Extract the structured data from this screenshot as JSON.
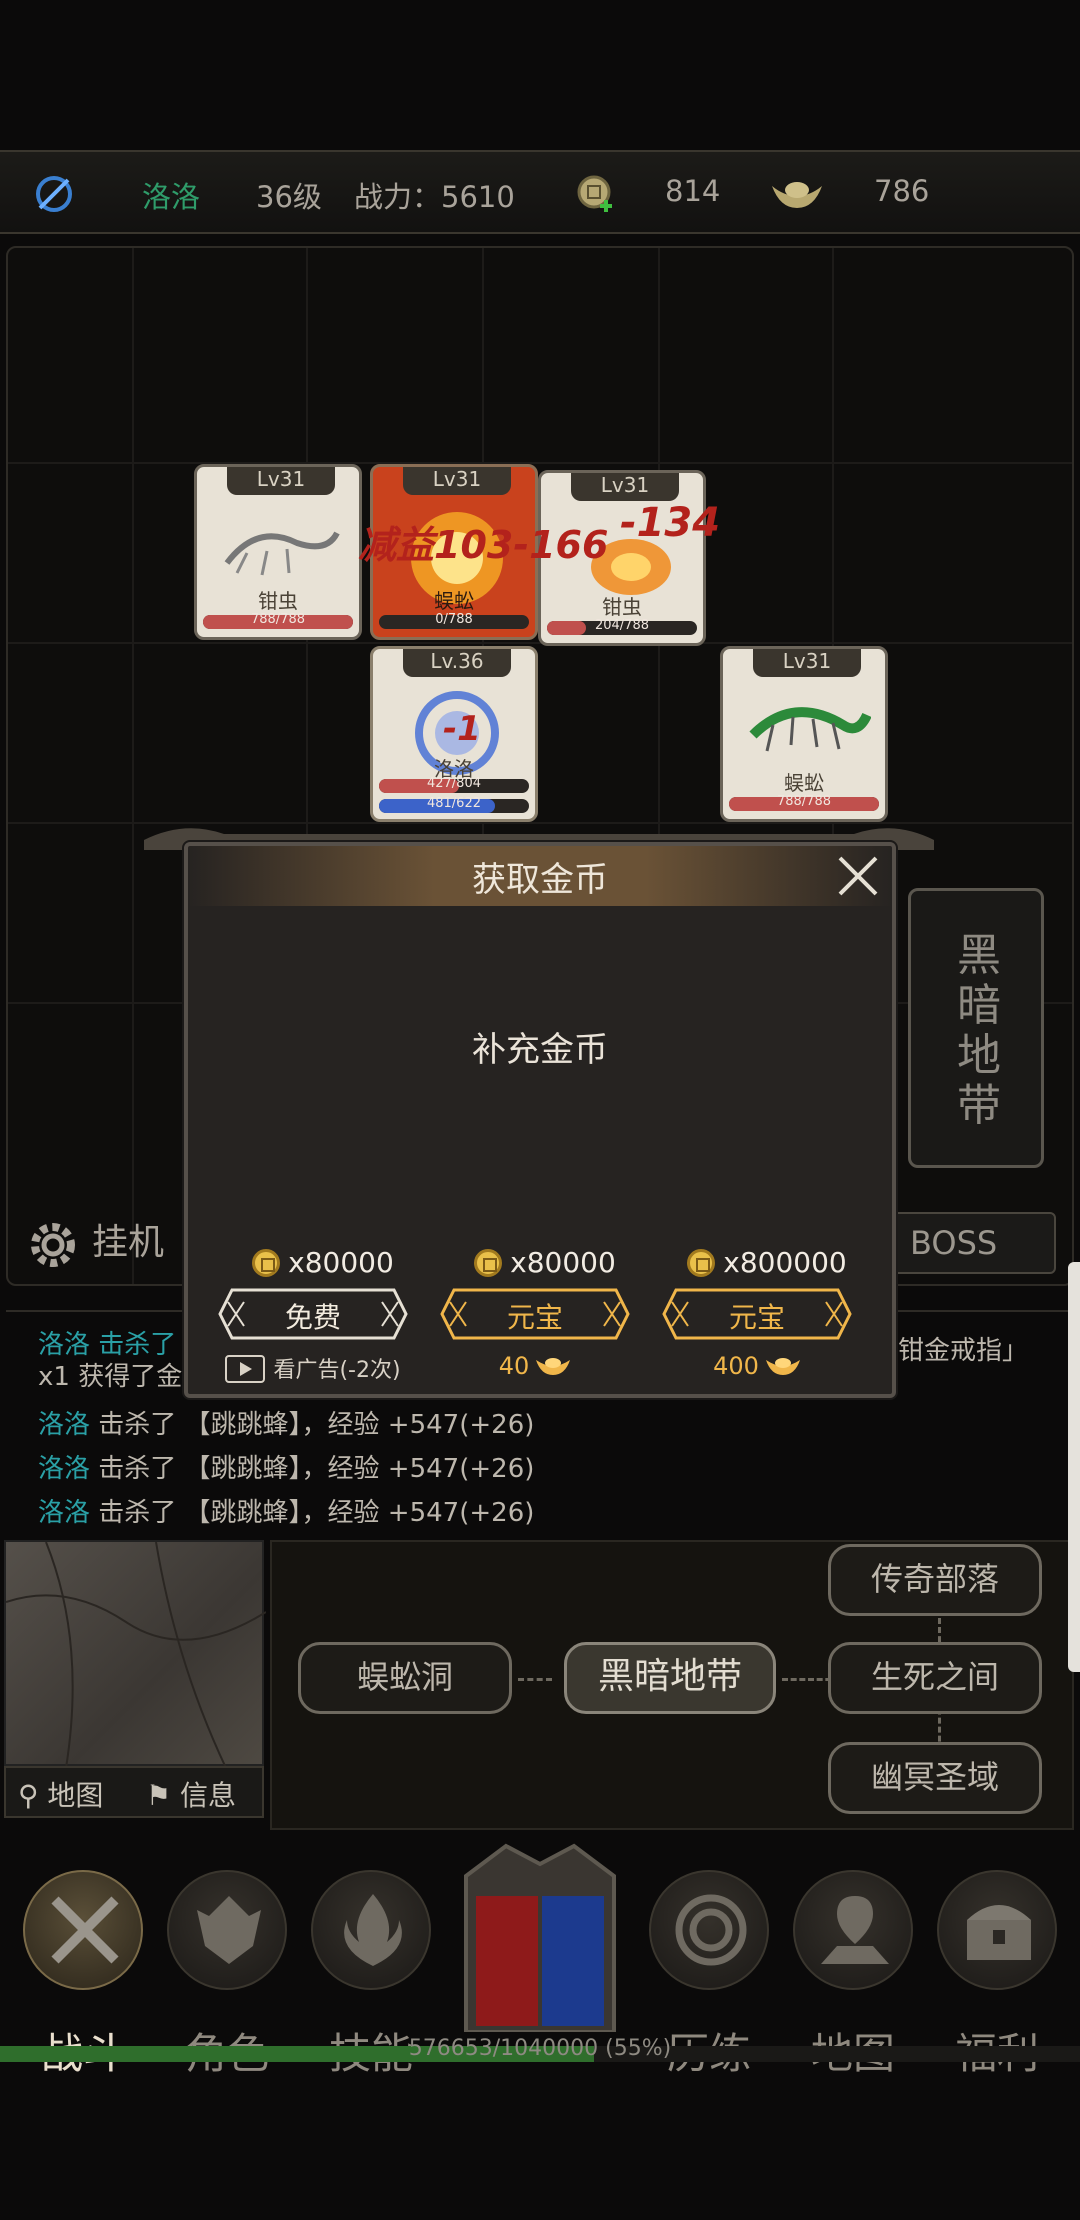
{
  "topbar": {
    "player_name": "洛洛",
    "level": "36级",
    "power": "战力：5610",
    "coins": "814",
    "ingots": "786"
  },
  "cards": [
    {
      "lv": "Lv31",
      "name": "钳虫",
      "hp": "788/788",
      "hp_pct": 100,
      "color": "#c0504d"
    },
    {
      "lv": "Lv31",
      "name": "蜈蚣",
      "hp": "0/788",
      "hp_pct": 0,
      "color": "#c0504d"
    },
    {
      "lv": "Lv31",
      "name": "钳虫",
      "hp": "204/788",
      "hp_pct": 26,
      "color": "#c0504d"
    },
    {
      "lv": "Lv.36",
      "name": "洛洛",
      "hp": "427/804",
      "mp": "481/622",
      "hp_pct": 53,
      "mp_pct": 77,
      "color": "#c0504d"
    },
    {
      "lv": "Lv31",
      "name": "蜈蚣",
      "hp": "788/788",
      "hp_pct": 100,
      "color": "#c0504d"
    }
  ],
  "battle_float_text": "减益103-166",
  "float_damage_1": "-134",
  "float_damage_2": "-1",
  "area_banner": "黑暗地带",
  "auto_label": "挂机",
  "boss_label": "BOSS",
  "log": {
    "partial_1": "洛洛 击杀了",
    "partial_1b": "x1 获得了金",
    "partial_right": "钳金戒指」",
    "lines": [
      {
        "who": "洛洛",
        "text": " 击杀了 【跳跳蜂】，经验 +547(+26)"
      },
      {
        "who": "洛洛",
        "text": " 击杀了 【跳跳蜂】，经验 +547(+26)"
      },
      {
        "who": "洛洛",
        "text": " 击杀了 【跳跳蜂】，经验 +547(+26)"
      }
    ]
  },
  "map_tabs": {
    "map": "地图",
    "info": "信息"
  },
  "route": {
    "left": "蜈蚣洞",
    "current": "黑暗地带",
    "right_top": "传奇部落",
    "right_mid": "生死之间",
    "right_bottom": "幽冥圣域"
  },
  "nav": [
    {
      "label": "战斗",
      "icon": "crossed-swords-icon",
      "active": true
    },
    {
      "label": "角色",
      "icon": "helmet-icon",
      "active": false
    },
    {
      "label": "技能",
      "icon": "flame-icon",
      "active": false
    },
    {
      "label": "历练",
      "icon": "vortex-icon",
      "active": false
    },
    {
      "label": "地图",
      "icon": "map-pin-icon",
      "active": false
    },
    {
      "label": "福利",
      "icon": "treasure-chest-icon",
      "active": false
    }
  ],
  "exp": {
    "text": "576653/1040000 (55%)",
    "fraction": 0.55
  },
  "modal": {
    "title": "获取金币",
    "message": "补充金币",
    "offers": [
      {
        "amount": "x80000",
        "button": "免费",
        "sub": "看广告(-2次)",
        "style": "plain"
      },
      {
        "amount": "x80000",
        "button": "元宝",
        "sub": "40",
        "style": "gold"
      },
      {
        "amount": "x800000",
        "button": "元宝",
        "sub": "400",
        "style": "gold"
      }
    ]
  },
  "colors": {
    "accent_gold": "#f0b64a",
    "name_green": "#2f9c6a",
    "log_cyan": "#2aa0a6"
  }
}
